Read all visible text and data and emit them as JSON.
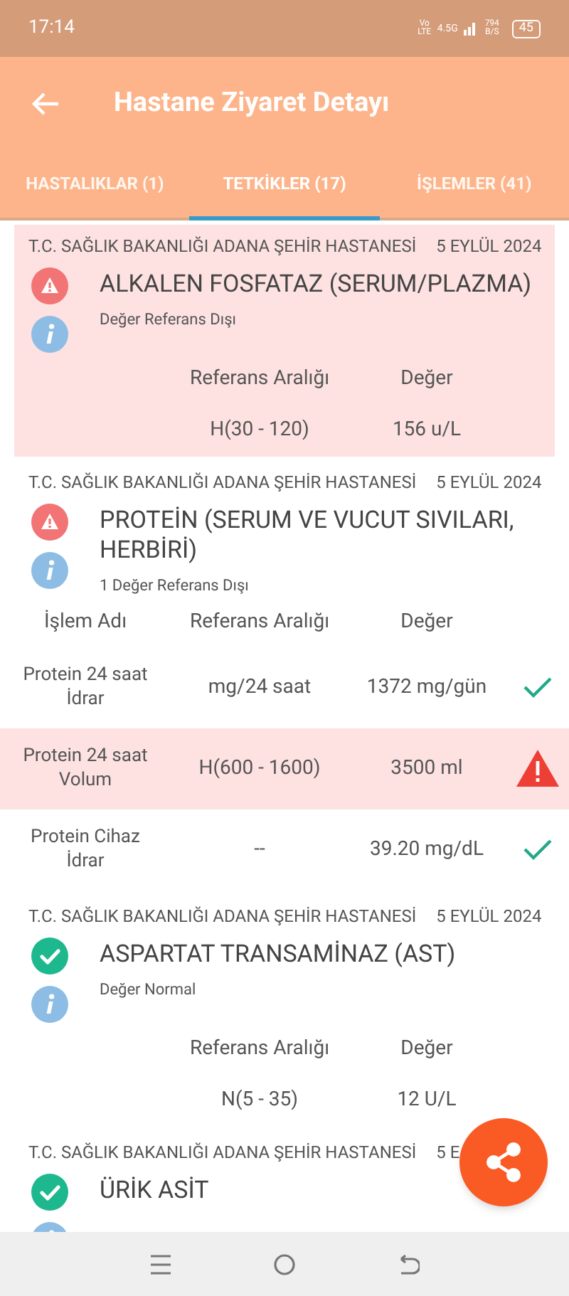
{
  "status_bar": {
    "time": "17:14",
    "volte": "Vo LTE",
    "network": "4.5G",
    "speed": "794 B/S",
    "battery": "45"
  },
  "app_bar": {
    "title": "Hastane Ziyaret Detayı"
  },
  "tabs": [
    {
      "label": "HASTALIKLAR (1)",
      "selected": false
    },
    {
      "label": "TETKİKLER (17)",
      "selected": true
    },
    {
      "label": "İŞLEMLER (41)",
      "selected": false
    }
  ],
  "cards": [
    {
      "kind": "summary",
      "hospital": "T.C. SAĞLIK BAKANLIĞI ADANA ŞEHİR HASTANESİ",
      "date": "5 EYLÜL 2024",
      "out_of_range": true,
      "highlighted": true,
      "title": "ALKALEN FOSFATAZ (SERUM/PLAZMA)",
      "note": "Değer Referans Dışı",
      "columns": [
        "Referans Aralığı",
        "Değer"
      ],
      "reference": "H(30 - 120)",
      "value": "156 u/L"
    },
    {
      "kind": "table",
      "hospital": "T.C. SAĞLIK BAKANLIĞI ADANA ŞEHİR HASTANESİ",
      "date": "5 EYLÜL 2024",
      "out_of_range": true,
      "highlighted": false,
      "title": "PROTEİN (SERUM VE VUCUT SIVILARI, HERBİRİ)",
      "note": "1 Değer Referans Dışı",
      "columns": [
        "İşlem Adı",
        "Referans Aralığı",
        "Değer"
      ],
      "rows": [
        {
          "name": "Protein 24 saat İdrar",
          "reference": "mg/24 saat",
          "value": "1372 mg/gün",
          "out_of_range": false
        },
        {
          "name": "Protein 24 saat Volum",
          "reference": "H(600 - 1600)",
          "value": "3500 ml",
          "out_of_range": true
        },
        {
          "name": "Protein Cihaz İdrar",
          "reference": "--",
          "value": "39.20 mg/dL",
          "out_of_range": false
        }
      ]
    },
    {
      "kind": "summary",
      "hospital": "T.C. SAĞLIK BAKANLIĞI ADANA ŞEHİR HASTANESİ",
      "date": "5 EYLÜL 2024",
      "out_of_range": false,
      "highlighted": false,
      "title": "ASPARTAT TRANSAMİNAZ (AST)",
      "note": "Değer Normal",
      "columns": [
        "Referans Aralığı",
        "Değer"
      ],
      "reference": "N(5 - 35)",
      "value": "12 U/L"
    },
    {
      "kind": "partial",
      "hospital": "T.C. SAĞLIK BAKANLIĞI ADANA ŞEHİR HASTANESİ",
      "date": "5 E",
      "out_of_range": false,
      "highlighted": false,
      "title": "ÜRİK ASİT"
    }
  ]
}
